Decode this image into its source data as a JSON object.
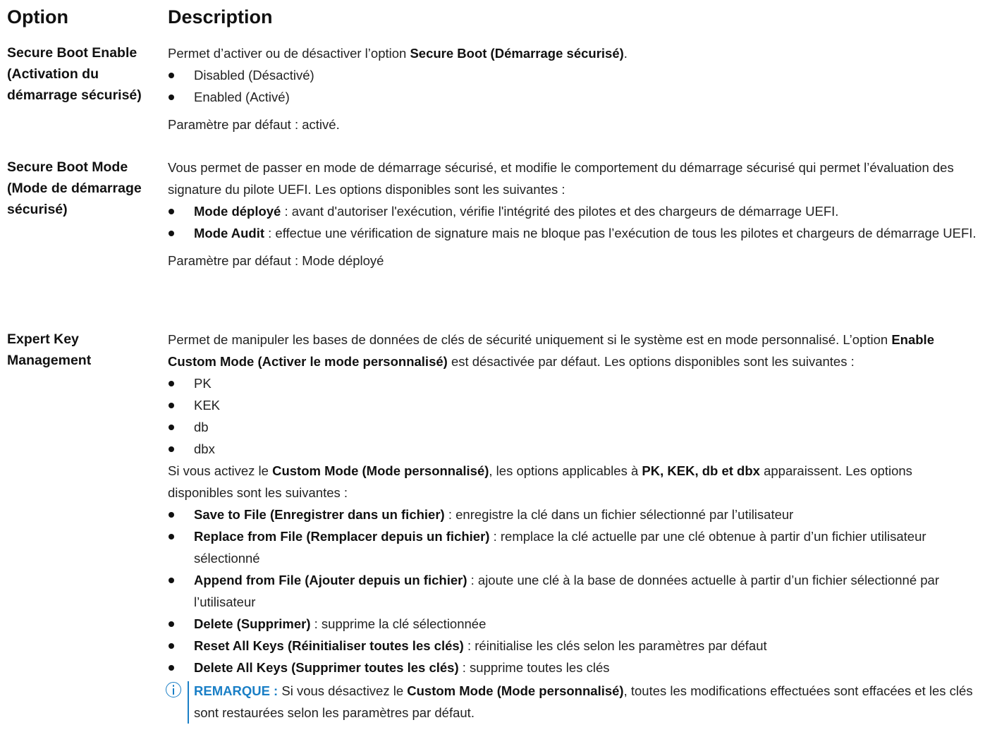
{
  "header": {
    "option": "Option",
    "description": "Description"
  },
  "rows": [
    {
      "option": "Secure Boot Enable (Activation du démarrage sécurisé)",
      "intro": "Permet d’activer ou de désactiver l’option ",
      "intro_bold": "Secure Boot (Démarrage sécurisé)",
      "intro_end": ".",
      "items": [
        "Disabled (Désactivé)",
        "Enabled (Activé)"
      ],
      "default": "Paramètre par défaut : activé."
    },
    {
      "option": "Secure Boot Mode (Mode de démarrage sécurisé)",
      "intro": "Vous permet de passer en mode de démarrage sécurisé, et modifie le comportement du démarrage sécurisé qui permet l’évaluation des signature du pilote UEFI. Les options disponibles sont les suivantes :",
      "items": [
        {
          "bold": "Mode déployé",
          "text": " : avant d'autoriser l'exécution, vérifie l'intégrité des pilotes et des chargeurs de démarrage UEFI."
        },
        {
          "bold": "Mode Audit",
          "text": " : effectue une vérification de signature mais ne bloque pas l’exécution de tous les pilotes et chargeurs de démarrage UEFI."
        }
      ],
      "default": "Paramètre par défaut : Mode déployé"
    },
    {
      "option": "Expert Key Management",
      "intro1": "Permet de manipuler les bases de données de clés de sécurité uniquement si le système est en mode personnalisé. L’option ",
      "intro1_bold": "Enable Custom Mode (Activer le mode personnalisé)",
      "intro1_end": " est désactivée par défaut. Les options disponibles sont les suivantes :",
      "items1": [
        "PK",
        "KEK",
        "db",
        "dbx"
      ],
      "intro2_a": "Si vous activez le ",
      "intro2_bold1": "Custom Mode (Mode personnalisé)",
      "intro2_b": ", les options applicables à ",
      "intro2_bold2": "PK, KEK, db et dbx",
      "intro2_c": " apparaissent. Les options disponibles sont les suivantes :",
      "items2": [
        {
          "bold": "Save to File (Enregistrer dans un fichier)",
          "text": " : enregistre la clé dans un fichier sélectionné par l’utilisateur"
        },
        {
          "bold": "Replace from File (Remplacer depuis un fichier)",
          "text": " : remplace la clé actuelle par une clé obtenue à partir d’un fichier utilisateur sélectionné"
        },
        {
          "bold": "Append from File (Ajouter depuis un fichier)",
          "text": " : ajoute une clé à la base de données actuelle à partir d’un fichier sélectionné par l’utilisateur"
        },
        {
          "bold": "Delete (Supprimer)",
          "text": " : supprime la clé sélectionnée"
        },
        {
          "bold": "Reset All Keys (Réinitialiser toutes les clés)",
          "text": " : réinitialise les clés selon les paramètres par défaut"
        },
        {
          "bold": "Delete All Keys (Supprimer toutes les clés)",
          "text": " : supprime toutes les clés"
        }
      ],
      "note": {
        "label": "REMARQUE :",
        "text_a": " Si vous désactivez le ",
        "bold": "Custom Mode (Mode personnalisé)",
        "text_b": ", toutes les modifications effectuées sont effacées et les clés sont restaurées selon les paramètres par défaut."
      }
    }
  ],
  "colors": {
    "note_accent": "#1a7fc6"
  }
}
